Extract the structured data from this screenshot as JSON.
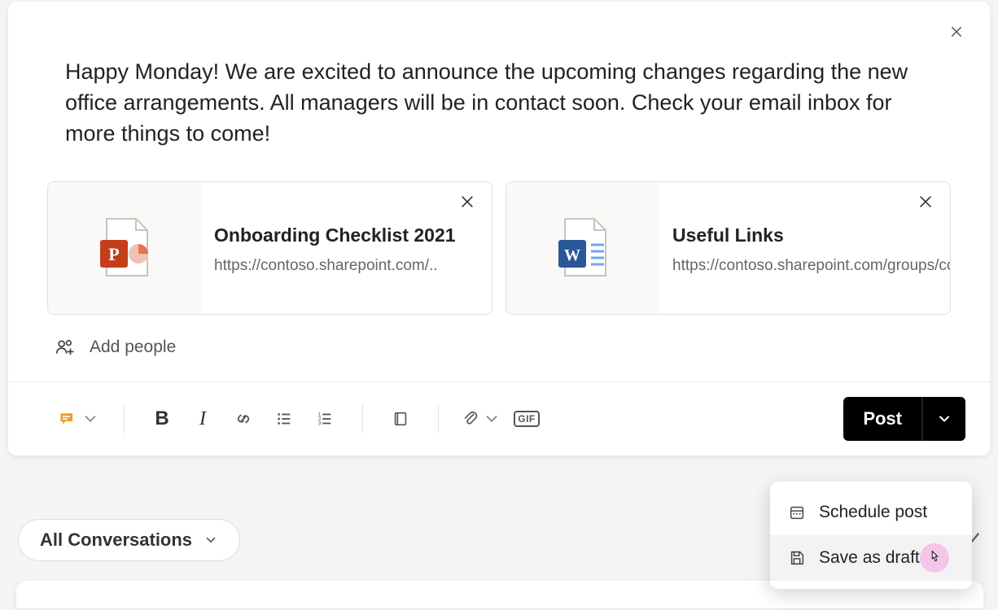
{
  "compose": {
    "message": "Happy Monday! We are excited to announce the upcoming changes regarding the new office arrangements. All managers will be in contact soon. Check your email inbox for more things to come!"
  },
  "attachments": [
    {
      "title": "Onboarding Checklist 2021",
      "url": "https://contoso.sharepoint.com/..",
      "app": "powerpoint"
    },
    {
      "title": "Useful Links",
      "url": "https://contoso.sharepoint.com/groups/contosonewemployees/...",
      "app": "word"
    }
  ],
  "addPeople": {
    "placeholder": "Add people"
  },
  "toolbar": {
    "post_label": "Post",
    "gif_label": "GIF"
  },
  "postMenu": {
    "items": [
      {
        "label": "Schedule post",
        "icon": "calendar-icon"
      },
      {
        "label": "Save as draft",
        "icon": "save-icon"
      }
    ]
  },
  "filter": {
    "label": "All Conversations"
  }
}
